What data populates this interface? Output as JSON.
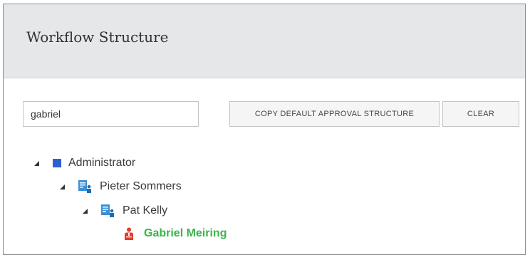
{
  "header": {
    "title": "Workflow Structure"
  },
  "search": {
    "value": "gabriel"
  },
  "toolbar": {
    "copy_label": "COPY DEFAULT APPROVAL STRUCTURE",
    "clear_label": "CLEAR"
  },
  "tree": {
    "nodes": [
      {
        "label": "Administrator",
        "icon": "square-icon",
        "expanded": true,
        "level": 0
      },
      {
        "label": "Pieter Sommers",
        "icon": "user-document-icon",
        "expanded": true,
        "level": 1
      },
      {
        "label": "Pat Kelly",
        "icon": "user-document-icon",
        "expanded": true,
        "level": 2
      },
      {
        "label": "Gabriel Meiring",
        "icon": "person-icon",
        "expanded": false,
        "level": 3,
        "match": true
      }
    ]
  },
  "colors": {
    "header_bg": "#e6e7e9",
    "admin_square": "#2f5fcf",
    "doc_icon": "#3b8fd6",
    "match_text": "#3cb34a",
    "person_icon": "#e23b2e"
  }
}
